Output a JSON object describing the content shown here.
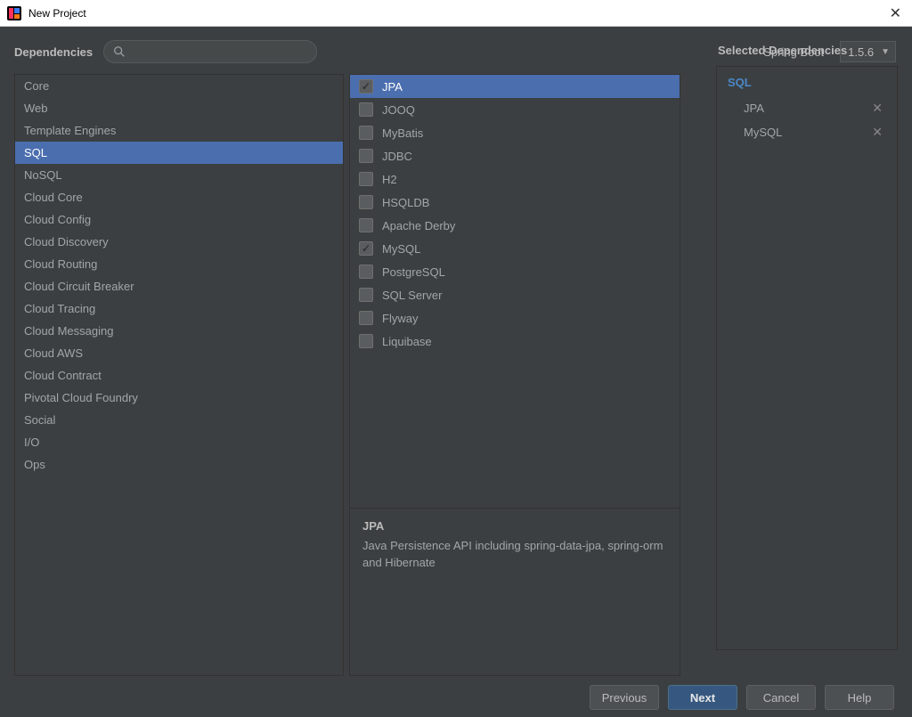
{
  "window": {
    "title": "New Project"
  },
  "header": {
    "dependencies_label": "Dependencies",
    "search_placeholder": "",
    "springboot_label": "Spring Boot",
    "springboot_version": "1.5.6"
  },
  "categories": [
    {
      "label": "Core",
      "selected": false
    },
    {
      "label": "Web",
      "selected": false
    },
    {
      "label": "Template Engines",
      "selected": false
    },
    {
      "label": "SQL",
      "selected": true
    },
    {
      "label": "NoSQL",
      "selected": false
    },
    {
      "label": "Cloud Core",
      "selected": false
    },
    {
      "label": "Cloud Config",
      "selected": false
    },
    {
      "label": "Cloud Discovery",
      "selected": false
    },
    {
      "label": "Cloud Routing",
      "selected": false
    },
    {
      "label": "Cloud Circuit Breaker",
      "selected": false
    },
    {
      "label": "Cloud Tracing",
      "selected": false
    },
    {
      "label": "Cloud Messaging",
      "selected": false
    },
    {
      "label": "Cloud AWS",
      "selected": false
    },
    {
      "label": "Cloud Contract",
      "selected": false
    },
    {
      "label": "Pivotal Cloud Foundry",
      "selected": false
    },
    {
      "label": "Social",
      "selected": false
    },
    {
      "label": "I/O",
      "selected": false
    },
    {
      "label": "Ops",
      "selected": false
    }
  ],
  "dependencies": [
    {
      "label": "JPA",
      "checked": true,
      "selected": true
    },
    {
      "label": "JOOQ",
      "checked": false,
      "selected": false
    },
    {
      "label": "MyBatis",
      "checked": false,
      "selected": false
    },
    {
      "label": "JDBC",
      "checked": false,
      "selected": false
    },
    {
      "label": "H2",
      "checked": false,
      "selected": false
    },
    {
      "label": "HSQLDB",
      "checked": false,
      "selected": false
    },
    {
      "label": "Apache Derby",
      "checked": false,
      "selected": false
    },
    {
      "label": "MySQL",
      "checked": true,
      "selected": false
    },
    {
      "label": "PostgreSQL",
      "checked": false,
      "selected": false
    },
    {
      "label": "SQL Server",
      "checked": false,
      "selected": false
    },
    {
      "label": "Flyway",
      "checked": false,
      "selected": false
    },
    {
      "label": "Liquibase",
      "checked": false,
      "selected": false
    }
  ],
  "description": {
    "title": "JPA",
    "text": "Java Persistence API including spring-data-jpa, spring-orm and Hibernate"
  },
  "selected_panel": {
    "title": "Selected Dependencies",
    "group": "SQL",
    "items": [
      {
        "label": "JPA"
      },
      {
        "label": "MySQL"
      }
    ]
  },
  "buttons": {
    "previous": "Previous",
    "next": "Next",
    "cancel": "Cancel",
    "help": "Help"
  }
}
